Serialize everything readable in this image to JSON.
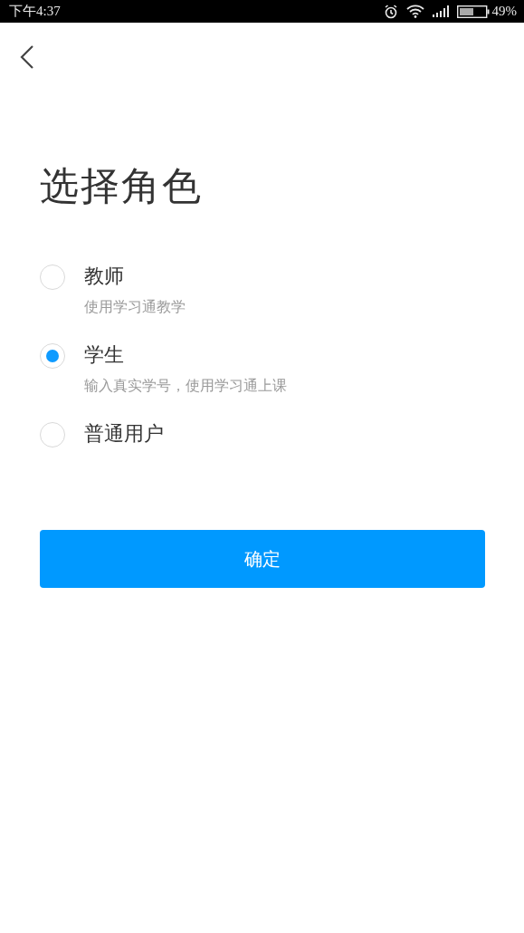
{
  "status_bar": {
    "time": "下午4:37",
    "battery": "49%"
  },
  "title": "选择角色",
  "roles": [
    {
      "label": "教师",
      "description": "使用学习通教学",
      "selected": false
    },
    {
      "label": "学生",
      "description": "输入真实学号，使用学习通上课",
      "selected": true
    },
    {
      "label": "普通用户",
      "selected": false
    }
  ],
  "confirm_button": "确定"
}
